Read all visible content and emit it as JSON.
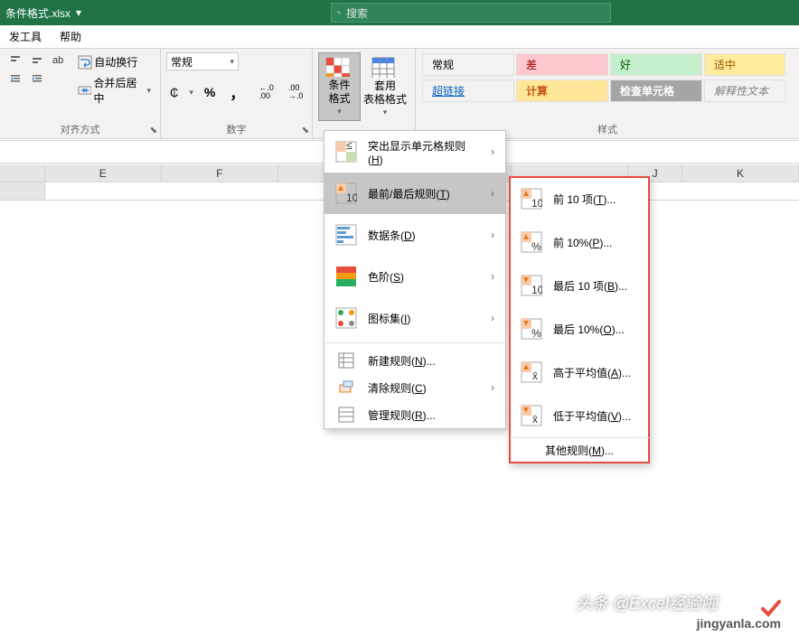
{
  "title": {
    "filename": "条件格式.xlsx",
    "dropdown": "▾"
  },
  "search": {
    "placeholder": "搜索"
  },
  "tabs": {
    "dev": "发工具",
    "help": "帮助"
  },
  "ribbon": {
    "align": {
      "ab_icon": "ab",
      "wrap": "自动换行",
      "merge": "合并后居中",
      "label": "对齐方式",
      "drop": "▾"
    },
    "number": {
      "format": "常规",
      "label": "数字",
      "drop": "▾",
      "pct": "%",
      "comma": "，",
      "inc": "←.0\n.00",
      "dec": ".00\n→.0",
      "cur": "₵"
    },
    "cf": {
      "cond_fmt": "条件格式",
      "table_fmt": "套用\n表格格式",
      "drop": "▾"
    },
    "styles": {
      "label": "样式",
      "normal": "常规",
      "bad": "差",
      "good": "好",
      "neutral": "适中",
      "link": "超链接",
      "calc": "计算",
      "check": "检查单元格",
      "expl": "解释性文本"
    }
  },
  "menu1": {
    "highlight": "突出显示单元格规则(H)",
    "top_bottom": "最前/最后规则(T)",
    "data_bars": "数据条(D)",
    "color_scales": "色阶(S)",
    "icon_sets": "图标集(I)",
    "new_rule": "新建规则(N)...",
    "clear": "清除规则(C)",
    "manage": "管理规则(R)...",
    "arrow": "›"
  },
  "menu2": {
    "top10": "前 10 项(T)...",
    "top10pct": "前 10%(P)...",
    "bottom10": "最后 10 项(B)...",
    "bottom10pct": "最后 10%(O)...",
    "above_avg": "高于平均值(A)...",
    "below_avg": "低于平均值(V)...",
    "other": "其他规则(M)..."
  },
  "cols": {
    "e": "E",
    "f": "F",
    "j": "J",
    "k": "K"
  },
  "watermark": {
    "text": "头条 @Excel经验啦",
    "site": "jingyanla.com",
    "check": "✓"
  }
}
